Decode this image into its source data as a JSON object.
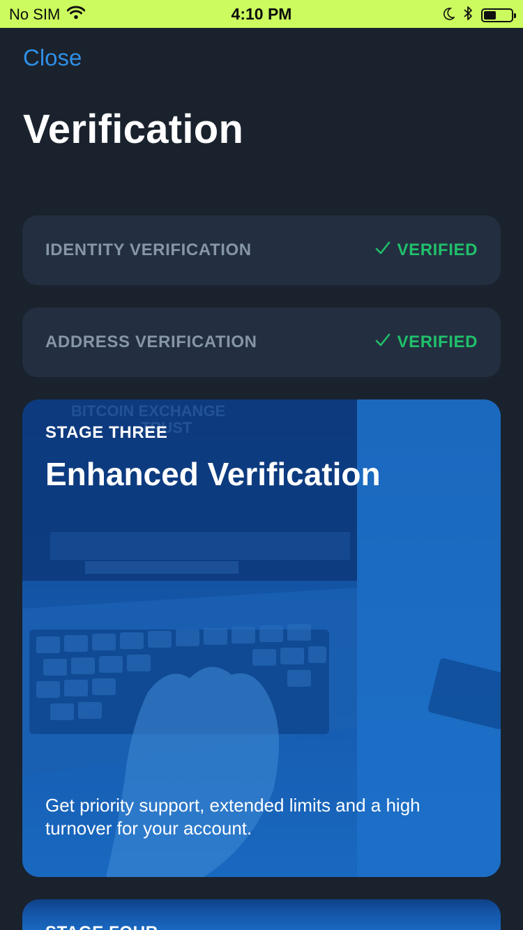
{
  "status_bar": {
    "carrier": "No SIM",
    "time": "4:10 PM",
    "battery_level": 0.45
  },
  "nav": {
    "close_label": "Close"
  },
  "page": {
    "title": "Verification"
  },
  "verifications": [
    {
      "label": "IDENTITY VERIFICATION",
      "status": "VERIFIED"
    },
    {
      "label": "ADDRESS VERIFICATION",
      "status": "VERIFIED"
    }
  ],
  "stages": [
    {
      "eyebrow": "STAGE THREE",
      "title": "Enhanced Verification",
      "description": "Get priority support, extended limits and a high turnover for your account.",
      "background_text": [
        "BITCOIN EXCHANGE",
        "TRUST"
      ]
    },
    {
      "eyebrow": "STAGE FOUR"
    }
  ],
  "colors": {
    "status_bar_bg": "#cbfb5e",
    "page_bg": "#1a222d",
    "row_bg": "#232f40",
    "verified_green": "#20c06b",
    "link_blue": "#2f8fe6",
    "card_blue": "#1456a8"
  },
  "icons": {
    "wifi": "wifi-icon",
    "moon": "moon-icon",
    "bluetooth": "bluetooth-icon",
    "battery": "battery-icon",
    "check": "checkmark-icon"
  }
}
